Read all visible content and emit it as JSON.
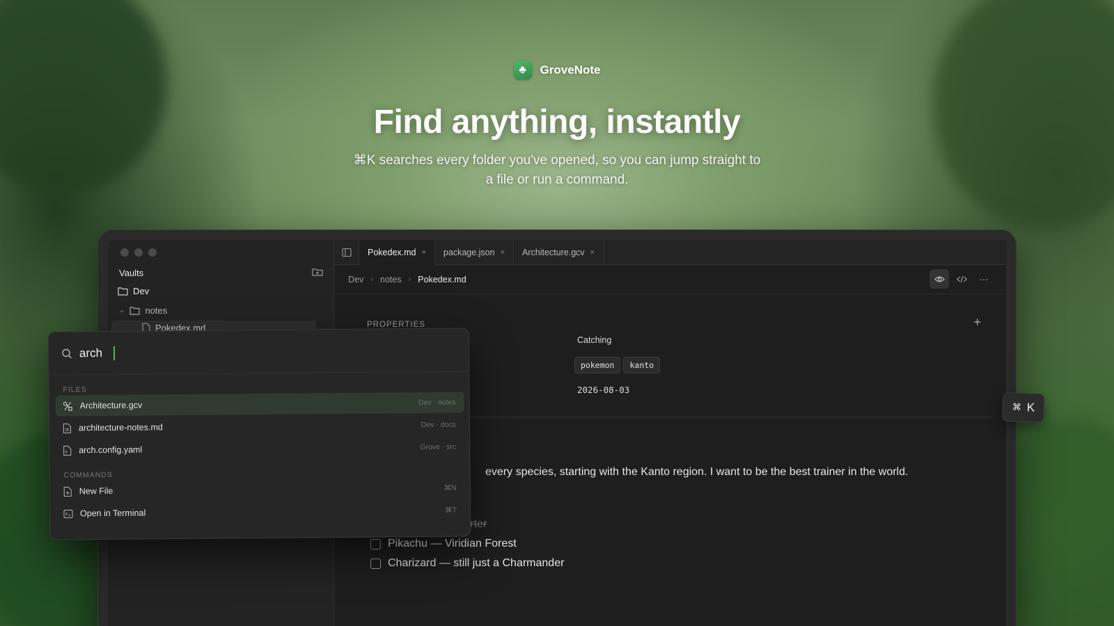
{
  "brand": {
    "name": "GroveNote",
    "logo": "clover-icon"
  },
  "hero": {
    "headline": "Find anything, instantly",
    "subline": "⌘K searches every folder you've opened, so you can jump straight to a file or run a command."
  },
  "sidebar": {
    "section_label": "Vaults",
    "tree": [
      {
        "label": "Dev",
        "icon": "folder-icon"
      },
      {
        "label": "notes",
        "icon": "folder-icon",
        "expanded": true
      },
      {
        "label": "Pokedex.md",
        "icon": "file-icon"
      }
    ]
  },
  "tabs": [
    {
      "label": "Pokedex.md",
      "active": true
    },
    {
      "label": "package.json",
      "active": false
    },
    {
      "label": "Architecture.gcv",
      "active": false
    }
  ],
  "breadcrumb": {
    "items": [
      "Dev",
      "notes"
    ],
    "current": "Pokedex.md"
  },
  "properties": {
    "title": "PROPERTIES",
    "status": "Catching",
    "tags": [
      "pokemon",
      "kanto"
    ],
    "date": "2026-08-03"
  },
  "document": {
    "paragraph_visible": "every species, starting with the Kanto region. I want to be the best trainer in the world.",
    "tasks": [
      {
        "label": "Bulbasaur — starter",
        "done": true
      },
      {
        "label": "Pikachu — Viridian Forest",
        "done": false
      },
      {
        "label": "Charizard — still just a Charmander",
        "done": false
      }
    ]
  },
  "palette": {
    "query": "arch",
    "files_label": "FILES",
    "files": [
      {
        "label": "Architecture.gcv",
        "meta": "Dev · notes",
        "selected": true
      },
      {
        "label": "architecture-notes.md",
        "meta": "Dev · docs",
        "selected": false
      },
      {
        "label": "arch.config.yaml",
        "meta": "Grove · src",
        "selected": false
      }
    ],
    "commands_label": "COMMANDS",
    "commands": [
      {
        "label": "New File",
        "shortcut": "⌘N"
      },
      {
        "label": "Open in Terminal",
        "shortcut": "⌘T"
      }
    ]
  },
  "shortcut_badge": {
    "modifier": "⌘",
    "key": "K"
  },
  "colors": {
    "accent": "#4fb86a",
    "selection": "#2f3b30",
    "window": "#1e1e1e"
  }
}
